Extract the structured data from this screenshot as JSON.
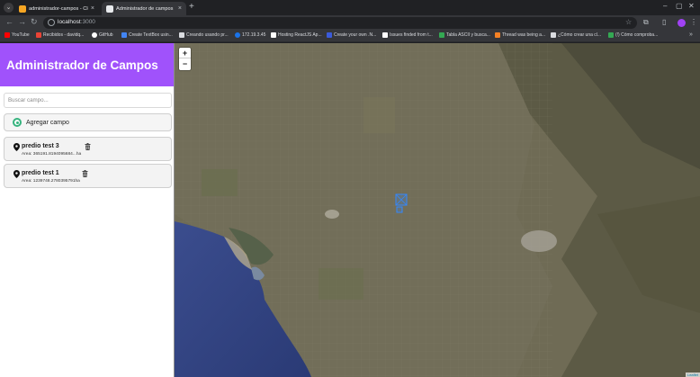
{
  "browser": {
    "tabs": [
      {
        "title": "administrador-campos - Cloud",
        "favicon_color": "#f6a623",
        "close_icon": "×",
        "active": false
      },
      {
        "title": "Administrador de campos",
        "favicon_color": "#e8eaed",
        "close_icon": "×",
        "active": true
      }
    ],
    "new_tab_icon": "+",
    "window_controls": [
      "–",
      "▢",
      "✕"
    ],
    "nav": {
      "back": "←",
      "forward": "→",
      "reload": "↻"
    },
    "address": {
      "host": "localhost",
      "port": ":3000"
    },
    "bookmarks": [
      {
        "label": "YouTube",
        "color": "#ff0000"
      },
      {
        "label": "Recibidos - davidq...",
        "color": "#ea4335"
      },
      {
        "label": "GitHub",
        "color": "#ffffff"
      },
      {
        "label": "Create TextBox usin...",
        "color": "#4285f4"
      },
      {
        "label": "Creando usando pr...",
        "color": "#dadce0"
      },
      {
        "label": "172.19.3.45",
        "color": "#1a73e8"
      },
      {
        "label": "Hosting ReactJS Ap...",
        "color": "#ffffff"
      },
      {
        "label": "Create your own .N...",
        "color": "#3b5bdb"
      },
      {
        "label": "Issues finded from t...",
        "color": "#ffffff"
      },
      {
        "label": "Tabla ASCII y busca...",
        "color": "#34a853"
      },
      {
        "label": "Thread was being a...",
        "color": "#f48024"
      },
      {
        "label": "¿Cómo crear una cl...",
        "color": "#dadce0"
      },
      {
        "label": "(!) Cómo comproba...",
        "color": "#34a853"
      }
    ],
    "bookmarks_more": "»"
  },
  "app": {
    "title": "Administrador de Campos",
    "search": {
      "placeholder": "Buscar campo...",
      "value": ""
    },
    "add_button": {
      "label": "Agregar campo"
    },
    "fields": [
      {
        "name": "predio test 3",
        "area": "Area: 365191.8194095684...ha"
      },
      {
        "name": "predio test 1",
        "area": "Area: 1239748.2780395791ha"
      }
    ],
    "map": {
      "zoom_in": "+",
      "zoom_out": "−",
      "attribution": "Leaflet",
      "polygon_color": "#3388ff"
    }
  }
}
